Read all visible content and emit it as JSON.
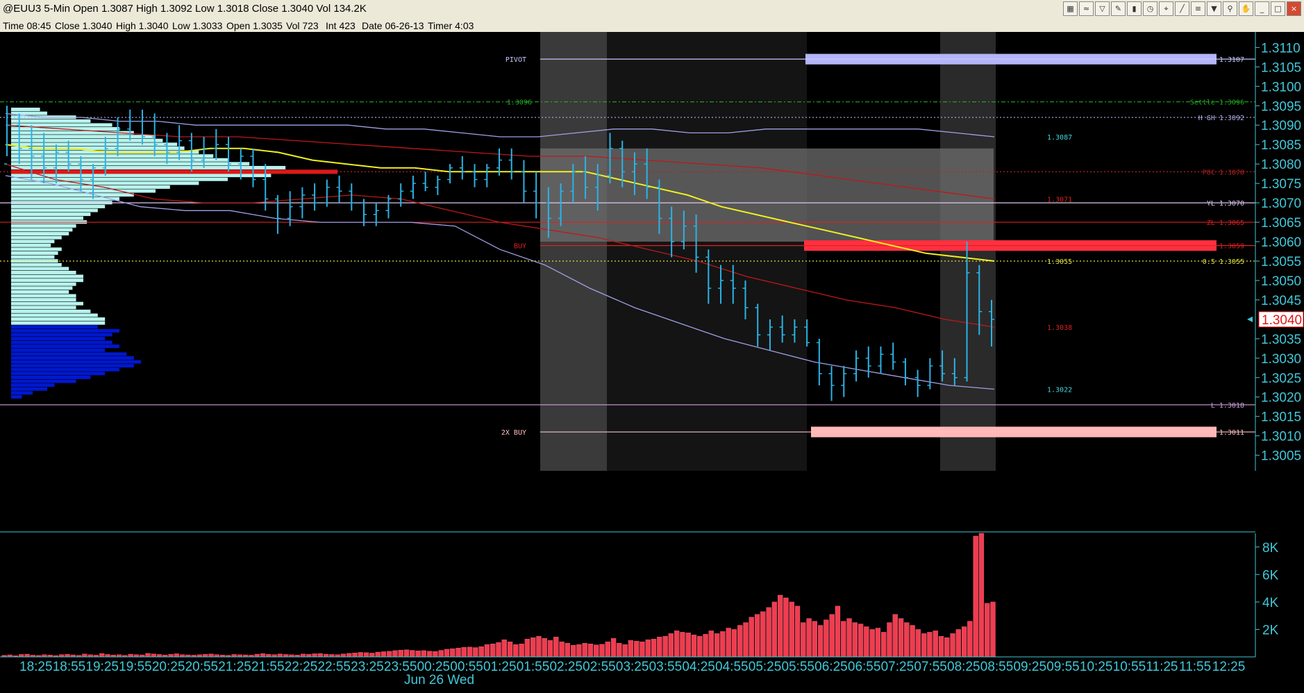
{
  "window": {
    "title": "@EUU3 5-Min Open 1.3087 High 1.3092 Low 1.3018 Close 1.3040 Vol 134.2K",
    "toolbar_icons": [
      "chart-icon",
      "lines-icon",
      "filter-icon",
      "pencil-icon",
      "bars-icon",
      "clock-icon",
      "cursor-icon",
      "draw-icon",
      "fib-icon",
      "trash-icon",
      "search-icon",
      "hand-icon",
      "minimize-icon",
      "maximize-icon",
      "close-icon"
    ]
  },
  "info_bar": {
    "time": "Time 08:45",
    "close": "Close 1.3040",
    "high": "High 1.3040",
    "low": "Low 1.3033",
    "open": "Open 1.3035",
    "vol": "Vol 723",
    "int": "Int 423",
    "date": "Date 06-26-13",
    "timer": "Timer 4:03"
  },
  "colors": {
    "background": "#000000",
    "price_bars": "#2ab3e6",
    "profile_light": "#b8f4ee",
    "profile_dark": "#0018d0",
    "axis_text": "#40c8d8",
    "vwap": "#f0f020",
    "band_red": "#c01818",
    "band_lavender": "#a0a0e8",
    "volume": "#f03c50",
    "current_price_box": "#ffffff",
    "current_price_text": "#e01818"
  },
  "chart_data": {
    "type": "line",
    "title": "@EUU3 5-Min",
    "ylim": [
      1.3001,
      1.3114
    ],
    "price_axis_ticks": [
      "1.3110",
      "1.3105",
      "1.3100",
      "1.3095",
      "1.3090",
      "1.3085",
      "1.3080",
      "1.3075",
      "1.3070",
      "1.3065",
      "1.3060",
      "1.3055",
      "1.3050",
      "1.3045",
      "1.3035",
      "1.3030",
      "1.3025",
      "1.3020",
      "1.3015",
      "1.3010",
      "1.3005"
    ],
    "current_price": {
      "value": 1.304,
      "label": "1.3040"
    },
    "time_axis_labels": [
      "18:25",
      "18:55",
      "19:25",
      "19:55",
      "20:25",
      "20:55",
      "21:25",
      "21:55",
      "22:25",
      "22:55",
      "23:25",
      "23:55",
      "00:25",
      "00:55",
      "01:25",
      "01:55",
      "02:25",
      "02:55",
      "03:25",
      "03:55",
      "04:25",
      "04:55",
      "05:25",
      "05:55",
      "06:25",
      "06:55",
      "07:25",
      "07:55",
      "08:25",
      "08:55",
      "09:25",
      "09:55",
      "10:25",
      "10:55",
      "11:25",
      "11:55",
      "12:25"
    ],
    "date_label": "Jun 26 Wed",
    "volume_axis_ticks": [
      "8K",
      "6K",
      "4K",
      "2K"
    ],
    "volume_ylim": [
      0,
      9000
    ],
    "level_lines": [
      {
        "price": 1.3107,
        "left_label": "PIVOT",
        "right_label": "1.3107",
        "color": "#c8c8ff",
        "style": "solid"
      },
      {
        "price": 1.3096,
        "left_label": "1.3096",
        "right_label": "Settle 1.3096",
        "color": "#20b020",
        "style": "dashdot"
      },
      {
        "price": 1.3092,
        "left_label": "",
        "right_label": "H GH 1.3092",
        "color": "#b0b0f0",
        "style": "dotted"
      },
      {
        "price": 1.3078,
        "left_label": "",
        "right_label": "POC 1.3078",
        "color": "#c02020",
        "style": "dotted"
      },
      {
        "price": 1.307,
        "left_label": "",
        "right_label": "YL 1.3070",
        "color": "#e0c8f0",
        "style": "solid"
      },
      {
        "price": 1.3065,
        "left_label": "",
        "right_label": "ZL 1.3065",
        "color": "#e02020",
        "style": "solid"
      },
      {
        "price": 1.3059,
        "left_label": "BUY",
        "right_label": "1.3059",
        "color": "#e02020",
        "style": "solid"
      },
      {
        "price": 1.3055,
        "left_label": "",
        "right_label": "0.5 1.3055",
        "color": "#e0e040",
        "style": "dotted"
      },
      {
        "price": 1.3018,
        "left_label": "",
        "right_label": "L 1.3018",
        "color": "#d0a0e0",
        "style": "solid"
      },
      {
        "price": 1.3011,
        "left_label": "2X BUY",
        "right_label": "1.3011",
        "color": "#ffc0c0",
        "style": "solid"
      }
    ],
    "value_markers": [
      {
        "price": 1.3087,
        "label": "1.3087",
        "color": "#40d8e0"
      },
      {
        "price": 1.3071,
        "label": "1.3071",
        "color": "#e02020"
      },
      {
        "price": 1.3055,
        "label": "1.3055",
        "color": "#e0e040"
      },
      {
        "price": 1.3038,
        "label": "1.3038",
        "color": "#e02020"
      },
      {
        "price": 1.3022,
        "label": "1.3022",
        "color": "#40d8e0"
      }
    ],
    "zones": [
      {
        "name": "upper-zone",
        "from": 1.3106,
        "to": 1.3108,
        "color": "#b4b4f8"
      },
      {
        "name": "buy-zone",
        "from": 1.3058,
        "to": 1.306,
        "color": "#ff3040"
      },
      {
        "name": "2x-buy-zone",
        "from": 1.301,
        "to": 1.3012,
        "color": "#ffb8b8"
      }
    ],
    "value_area_box": {
      "from": 1.306,
      "to": 1.3084
    },
    "price_series": [
      [
        1.308,
        1.3095,
        1.3082,
        1.309
      ],
      [
        1.309,
        1.3093,
        1.308,
        1.3084
      ],
      [
        1.3084,
        1.309,
        1.3076,
        1.3082
      ],
      [
        1.3082,
        1.3088,
        1.3075,
        1.3079
      ],
      [
        1.3079,
        1.3085,
        1.3075,
        1.3083
      ],
      [
        1.3083,
        1.3086,
        1.3078,
        1.308
      ],
      [
        1.308,
        1.3082,
        1.3073,
        1.3076
      ],
      [
        1.3076,
        1.308,
        1.3071,
        1.3079
      ],
      [
        1.3079,
        1.3087,
        1.3077,
        1.3084
      ],
      [
        1.3084,
        1.3092,
        1.3082,
        1.3089
      ],
      [
        1.3089,
        1.3094,
        1.3086,
        1.3091
      ],
      [
        1.3091,
        1.3094,
        1.3085,
        1.3087
      ],
      [
        1.3087,
        1.3093,
        1.3082,
        1.3085
      ],
      [
        1.3085,
        1.3088,
        1.308,
        1.3083
      ],
      [
        1.3083,
        1.309,
        1.3081,
        1.3086
      ],
      [
        1.3086,
        1.3088,
        1.3078,
        1.3081
      ],
      [
        1.3081,
        1.3087,
        1.3079,
        1.3084
      ],
      [
        1.3084,
        1.3089,
        1.3081,
        1.3085
      ],
      [
        1.3085,
        1.3087,
        1.3078,
        1.308
      ],
      [
        1.308,
        1.3084,
        1.3076,
        1.3082
      ],
      [
        1.3082,
        1.3084,
        1.3074,
        1.3076
      ],
      [
        1.3076,
        1.308,
        1.3068,
        1.3071
      ],
      [
        1.3071,
        1.3072,
        1.3062,
        1.3066
      ],
      [
        1.3066,
        1.3073,
        1.3064,
        1.3069
      ],
      [
        1.3069,
        1.3074,
        1.3066,
        1.3072
      ],
      [
        1.3072,
        1.3075,
        1.3068,
        1.307
      ],
      [
        1.307,
        1.3076,
        1.3069,
        1.3074
      ],
      [
        1.3074,
        1.3077,
        1.307,
        1.3073
      ],
      [
        1.3073,
        1.3075,
        1.3068,
        1.307
      ],
      [
        1.307,
        1.3071,
        1.3064,
        1.3067
      ],
      [
        1.3067,
        1.307,
        1.3064,
        1.3068
      ],
      [
        1.3068,
        1.3072,
        1.3066,
        1.3071
      ],
      [
        1.3071,
        1.3075,
        1.3069,
        1.3073
      ],
      [
        1.3073,
        1.3077,
        1.3071,
        1.3075
      ],
      [
        1.3075,
        1.3078,
        1.3073,
        1.3074
      ],
      [
        1.3074,
        1.3077,
        1.3072,
        1.3076
      ],
      [
        1.3076,
        1.308,
        1.3075,
        1.3079
      ],
      [
        1.3079,
        1.3082,
        1.3076,
        1.3078
      ],
      [
        1.3078,
        1.308,
        1.3074,
        1.3076
      ],
      [
        1.3076,
        1.308,
        1.3074,
        1.3079
      ],
      [
        1.3079,
        1.3084,
        1.3077,
        1.3081
      ],
      [
        1.3081,
        1.3084,
        1.3076,
        1.3078
      ],
      [
        1.3078,
        1.3081,
        1.307,
        1.3073
      ],
      [
        1.3073,
        1.3078,
        1.3066,
        1.307
      ],
      [
        1.307,
        1.3074,
        1.3061,
        1.3066
      ],
      [
        1.3066,
        1.3075,
        1.3064,
        1.3073
      ],
      [
        1.3073,
        1.308,
        1.307,
        1.3078
      ],
      [
        1.3078,
        1.3082,
        1.3071,
        1.3074
      ],
      [
        1.3074,
        1.308,
        1.3068,
        1.3077
      ],
      [
        1.3077,
        1.3088,
        1.3075,
        1.3084
      ],
      [
        1.3084,
        1.3086,
        1.3074,
        1.3078
      ],
      [
        1.3078,
        1.3083,
        1.3072,
        1.308
      ],
      [
        1.308,
        1.3084,
        1.3071,
        1.3074
      ],
      [
        1.3074,
        1.3076,
        1.3062,
        1.3066
      ],
      [
        1.3066,
        1.3069,
        1.3056,
        1.306
      ],
      [
        1.306,
        1.3068,
        1.3058,
        1.3064
      ],
      [
        1.3064,
        1.3067,
        1.3052,
        1.3056
      ],
      [
        1.3056,
        1.3058,
        1.3044,
        1.3048
      ],
      [
        1.3048,
        1.3054,
        1.3044,
        1.305
      ],
      [
        1.305,
        1.3054,
        1.3044,
        1.3048
      ],
      [
        1.3048,
        1.305,
        1.304,
        1.3043
      ],
      [
        1.3043,
        1.3044,
        1.3033,
        1.3036
      ],
      [
        1.3036,
        1.304,
        1.3032,
        1.3038
      ],
      [
        1.3038,
        1.3041,
        1.3034,
        1.3036
      ],
      [
        1.3036,
        1.304,
        1.3034,
        1.3038
      ],
      [
        1.3038,
        1.304,
        1.3033,
        1.3034
      ],
      [
        1.3034,
        1.3035,
        1.3023,
        1.3026
      ],
      [
        1.3026,
        1.3028,
        1.3019,
        1.3023
      ],
      [
        1.3023,
        1.3028,
        1.302,
        1.3026
      ],
      [
        1.3026,
        1.3032,
        1.3024,
        1.303
      ],
      [
        1.303,
        1.3033,
        1.3025,
        1.3028
      ],
      [
        1.3028,
        1.3033,
        1.3026,
        1.3031
      ],
      [
        1.3031,
        1.3034,
        1.3027,
        1.3029
      ],
      [
        1.3029,
        1.303,
        1.3023,
        1.3025
      ],
      [
        1.3025,
        1.3027,
        1.302,
        1.3023
      ],
      [
        1.3023,
        1.303,
        1.3022,
        1.3028
      ],
      [
        1.3028,
        1.3032,
        1.3024,
        1.3026
      ],
      [
        1.3026,
        1.303,
        1.3023,
        1.3025
      ],
      [
        1.3025,
        1.306,
        1.3024,
        1.3052
      ],
      [
        1.3052,
        1.3054,
        1.3036,
        1.3042
      ],
      [
        1.3042,
        1.3045,
        1.3033,
        1.304
      ]
    ],
    "vwap_series": [
      1.3085,
      1.3084,
      1.3084,
      1.3083,
      1.3083,
      1.3083,
      1.3084,
      1.3084,
      1.3083,
      1.3081,
      1.308,
      1.3079,
      1.3079,
      1.3078,
      1.3078,
      1.3078,
      1.3078,
      1.3078,
      1.3076,
      1.3074,
      1.3072,
      1.3069,
      1.3067,
      1.3065,
      1.3063,
      1.3061,
      1.3059,
      1.3057,
      1.3056,
      1.3055
    ],
    "upper_band_series": [
      1.3093,
      1.3092,
      1.3092,
      1.3091,
      1.3091,
      1.309,
      1.309,
      1.309,
      1.309,
      1.309,
      1.3089,
      1.3089,
      1.3088,
      1.3087,
      1.3087,
      1.3088,
      1.3089,
      1.3089,
      1.3088,
      1.3088,
      1.3089,
      1.3089,
      1.3089,
      1.3089,
      1.3089,
      1.3088,
      1.3087
    ],
    "red_upper_series": [
      1.309,
      1.3089,
      1.3088,
      1.3087,
      1.3087,
      1.3086,
      1.3085,
      1.3084,
      1.3083,
      1.3082,
      1.3082,
      1.3081,
      1.308,
      1.3079,
      1.3077,
      1.3075,
      1.3073,
      1.3071
    ],
    "red_lower_series": [
      1.308,
      1.3076,
      1.3074,
      1.3071,
      1.307,
      1.307,
      1.3071,
      1.3072,
      1.3071,
      1.3068,
      1.3065,
      1.3063,
      1.3061,
      1.3058,
      1.3055,
      1.3051,
      1.3048,
      1.3045,
      1.3043,
      1.304,
      1.3038
    ],
    "lower_band_series": [
      1.3077,
      1.3075,
      1.3072,
      1.3069,
      1.3068,
      1.3068,
      1.3066,
      1.3065,
      1.3065,
      1.3065,
      1.3064,
      1.3058,
      1.3054,
      1.3048,
      1.3043,
      1.3039,
      1.3035,
      1.3032,
      1.3029,
      1.3027,
      1.3025,
      1.3023,
      1.3022
    ],
    "volume_series": [
      120,
      150,
      90,
      180,
      200,
      130,
      110,
      160,
      140,
      100,
      170,
      190,
      150,
      120,
      210,
      160,
      130,
      250,
      180,
      140,
      160,
      120,
      200,
      170,
      150,
      260,
      220,
      180,
      140,
      190,
      230,
      170,
      150,
      130,
      160,
      190,
      210,
      170,
      140,
      120,
      180,
      160,
      150,
      130,
      200,
      240,
      190,
      170,
      220,
      180,
      160,
      140,
      210,
      190,
      230,
      250,
      200,
      180,
      160,
      220,
      260,
      290,
      330,
      310,
      280,
      350,
      380,
      410,
      460,
      500,
      520,
      480,
      440,
      460,
      420,
      400,
      480,
      560,
      600,
      650,
      700,
      720,
      680,
      750,
      900,
      950,
      1050,
      1250,
      1100,
      900,
      950,
      1300,
      1400,
      1500,
      1350,
      1200,
      1450,
      1100,
      1000,
      850,
      900,
      1000,
      950,
      880,
      920,
      1100,
      1350,
      1000,
      900,
      1200,
      1150,
      1100,
      1250,
      1300,
      1450,
      1500,
      1700,
      1900,
      1800,
      1750,
      1600,
      1500,
      1650,
      1900,
      1700,
      1850,
      2100,
      2000,
      2300,
      2500,
      2900,
      3100,
      3300,
      3600,
      4000,
      4500,
      4300,
      4000,
      3700,
      2500,
      2800,
      2600,
      2300,
      2700,
      3100,
      3700,
      2600,
      2800,
      2500,
      2400,
      2200,
      2000,
      2100,
      1800,
      2500,
      3100,
      2800,
      2500,
      2300,
      2000,
      1700,
      1800,
      1900,
      1500,
      1400,
      1700,
      2000,
      2200,
      2600,
      8800,
      9000,
      3900,
      4000
    ]
  },
  "profile": {
    "rows": [
      {
        "price": 1.3094,
        "len": 8
      },
      {
        "price": 1.3093,
        "len": 10
      },
      {
        "price": 1.3092,
        "len": 18
      },
      {
        "price": 1.3091,
        "len": 22
      },
      {
        "price": 1.309,
        "len": 28
      },
      {
        "price": 1.3089,
        "len": 30
      },
      {
        "price": 1.3088,
        "len": 34
      },
      {
        "price": 1.3087,
        "len": 40
      },
      {
        "price": 1.3086,
        "len": 42
      },
      {
        "price": 1.3085,
        "len": 46
      },
      {
        "price": 1.3084,
        "len": 48
      },
      {
        "price": 1.3083,
        "len": 52
      },
      {
        "price": 1.3082,
        "len": 56
      },
      {
        "price": 1.3081,
        "len": 60
      },
      {
        "price": 1.308,
        "len": 66
      },
      {
        "price": 1.3079,
        "len": 76
      },
      {
        "price": 1.3078,
        "len": 80
      },
      {
        "price": 1.3077,
        "len": 72
      },
      {
        "price": 1.3076,
        "len": 60
      },
      {
        "price": 1.3075,
        "len": 52
      },
      {
        "price": 1.3074,
        "len": 44
      },
      {
        "price": 1.3073,
        "len": 40
      },
      {
        "price": 1.3072,
        "len": 34
      },
      {
        "price": 1.3071,
        "len": 30
      },
      {
        "price": 1.307,
        "len": 28
      },
      {
        "price": 1.3069,
        "len": 26
      },
      {
        "price": 1.3068,
        "len": 24
      },
      {
        "price": 1.3067,
        "len": 22
      },
      {
        "price": 1.3066,
        "len": 20
      },
      {
        "price": 1.3065,
        "len": 21
      },
      {
        "price": 1.3064,
        "len": 18
      },
      {
        "price": 1.3063,
        "len": 17
      },
      {
        "price": 1.3062,
        "len": 16
      },
      {
        "price": 1.3061,
        "len": 14
      },
      {
        "price": 1.306,
        "len": 12
      },
      {
        "price": 1.3059,
        "len": 11
      },
      {
        "price": 1.3058,
        "len": 14
      },
      {
        "price": 1.3057,
        "len": 13
      },
      {
        "price": 1.3056,
        "len": 12
      },
      {
        "price": 1.3055,
        "len": 13
      },
      {
        "price": 1.3054,
        "len": 14
      },
      {
        "price": 1.3053,
        "len": 16
      },
      {
        "price": 1.3052,
        "len": 18
      },
      {
        "price": 1.3051,
        "len": 20
      },
      {
        "price": 1.305,
        "len": 20
      },
      {
        "price": 1.3049,
        "len": 18
      },
      {
        "price": 1.3048,
        "len": 17
      },
      {
        "price": 1.3047,
        "len": 16
      },
      {
        "price": 1.3046,
        "len": 18
      },
      {
        "price": 1.3045,
        "len": 18
      },
      {
        "price": 1.3044,
        "len": 20
      },
      {
        "price": 1.3043,
        "len": 18
      },
      {
        "price": 1.3042,
        "len": 22
      },
      {
        "price": 1.3041,
        "len": 24
      },
      {
        "price": 1.304,
        "len": 26
      },
      {
        "price": 1.3039,
        "len": 26
      },
      {
        "price": 1.3038,
        "len": 24
      },
      {
        "price": 1.3037,
        "len": 30
      },
      {
        "price": 1.3036,
        "len": 28
      },
      {
        "price": 1.3035,
        "len": 26
      },
      {
        "price": 1.3034,
        "len": 28
      },
      {
        "price": 1.3033,
        "len": 30
      },
      {
        "price": 1.3032,
        "len": 26
      },
      {
        "price": 1.3031,
        "len": 32
      },
      {
        "price": 1.303,
        "len": 34
      },
      {
        "price": 1.3029,
        "len": 36
      },
      {
        "price": 1.3028,
        "len": 34
      },
      {
        "price": 1.3027,
        "len": 30
      },
      {
        "price": 1.3026,
        "len": 26
      },
      {
        "price": 1.3025,
        "len": 22
      },
      {
        "price": 1.3024,
        "len": 18
      },
      {
        "price": 1.3023,
        "len": 12
      },
      {
        "price": 1.3022,
        "len": 10
      },
      {
        "price": 1.3021,
        "len": 6
      },
      {
        "price": 1.302,
        "len": 3
      }
    ],
    "split_price": 1.3039
  }
}
